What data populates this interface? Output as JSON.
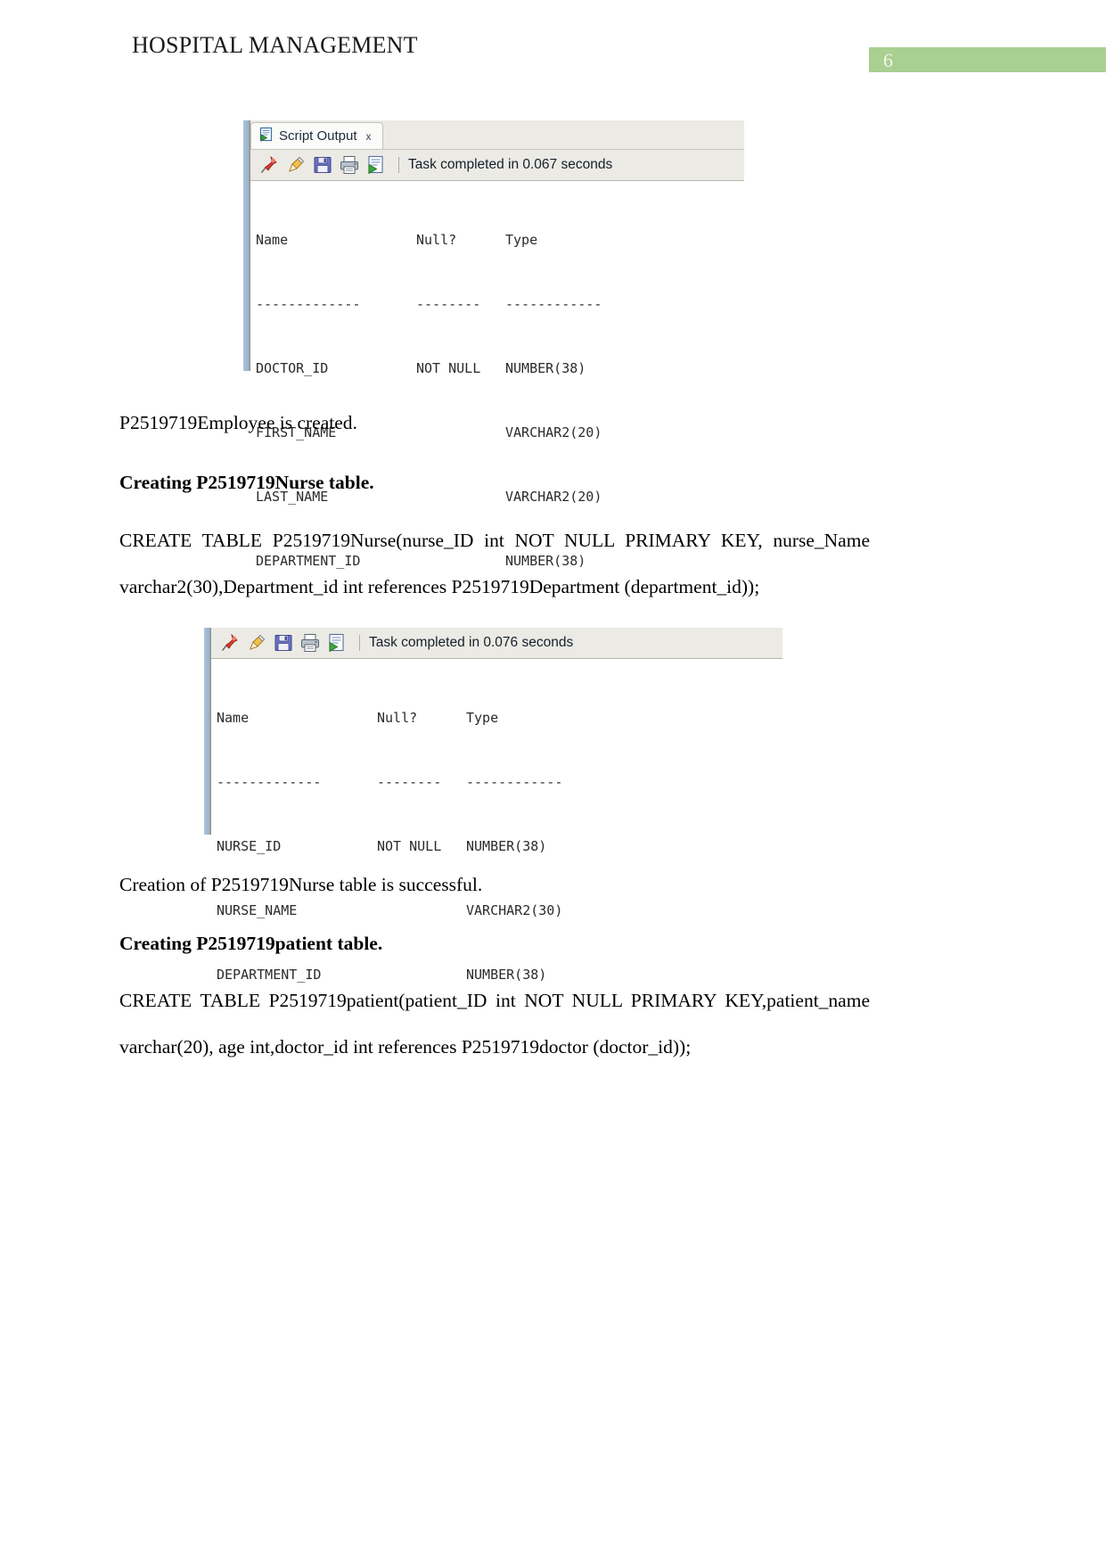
{
  "header": {
    "title": "HOSPITAL MANAGEMENT",
    "page_number": "6",
    "badge_color": "#a9cf91"
  },
  "panels": [
    {
      "id": "doctor",
      "tab": {
        "label": "Script Output",
        "close": "x",
        "icon": "script-output-icon"
      },
      "toolbar": {
        "icons": [
          "pin-icon",
          "eraser-icon",
          "save-icon",
          "print-icon",
          "script-run-icon"
        ],
        "status": "Task completed in 0.067 seconds"
      },
      "output": {
        "headers": {
          "name": "Name",
          "null": "Null?",
          "type": "Type"
        },
        "rule": {
          "name": "-------------",
          "null": "--------",
          "type": "------------"
        },
        "rows": [
          {
            "name": "DOCTOR_ID",
            "null": "NOT NULL",
            "type": "NUMBER(38)"
          },
          {
            "name": "FIRST_NAME",
            "null": "",
            "type": "VARCHAR2(20)"
          },
          {
            "name": "LAST_NAME",
            "null": "",
            "type": "VARCHAR2(20)"
          },
          {
            "name": "DEPARTMENT_ID",
            "null": "",
            "type": "NUMBER(38)"
          }
        ]
      }
    },
    {
      "id": "nurse",
      "tab": {
        "label": "",
        "close": "",
        "icon": ""
      },
      "toolbar": {
        "icons": [
          "pin-icon",
          "eraser-icon",
          "save-icon",
          "print-icon",
          "script-run-icon"
        ],
        "status": "Task completed in 0.076 seconds"
      },
      "output": {
        "headers": {
          "name": "Name",
          "null": "Null?",
          "type": "Type"
        },
        "rule": {
          "name": "-------------",
          "null": "--------",
          "type": "------------"
        },
        "rows": [
          {
            "name": "NURSE_ID",
            "null": "NOT NULL",
            "type": "NUMBER(38)"
          },
          {
            "name": "NURSE_NAME",
            "null": "",
            "type": "VARCHAR2(30)"
          },
          {
            "name": "DEPARTMENT_ID",
            "null": "",
            "type": "NUMBER(38)"
          }
        ]
      }
    }
  ],
  "content": {
    "p_employee_created": "P2519719Employee is created.",
    "h_creating_nurse": "Creating P2519719Nurse table.",
    "sql_nurse": "CREATE TABLE P2519719Nurse(nurse_ID int NOT NULL PRIMARY KEY,  nurse_Name varchar2(30),Department_id int references P2519719Department (department_id));",
    "p_nurse_success": "Creation of P2519719Nurse table is successful.",
    "h_creating_patient": "Creating P2519719patient table.",
    "sql_patient": "CREATE TABLE P2519719patient(patient_ID int NOT NULL PRIMARY KEY,patient_name varchar(20), age int,doctor_id int references P2519719doctor (doctor_id));"
  }
}
